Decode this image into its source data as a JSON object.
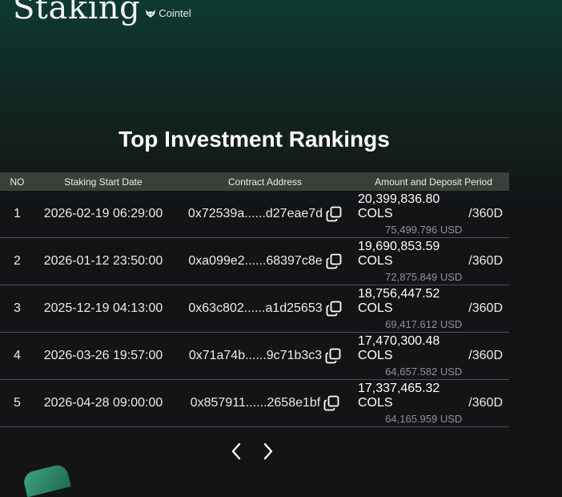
{
  "brand": {
    "title": "Staking",
    "logo_text": "Cointel"
  },
  "heading": "Top Investment Rankings",
  "table": {
    "headers": {
      "no": "NO",
      "date": "Staking Start Date",
      "address": "Contract Address",
      "amount": "Amount and Deposit Period"
    },
    "rows": [
      {
        "no": "1",
        "date": "2026-02-19 06:29:00",
        "address": "0x72539a......d27eae7d",
        "cols": "20,399,836.80 COLS",
        "usd": "75,499.796 USD",
        "period": "/360D"
      },
      {
        "no": "2",
        "date": "2026-01-12 23:50:00",
        "address": "0xa099e2......68397c8e",
        "cols": "19,690,853.59 COLS",
        "usd": "72,875.849 USD",
        "period": "/360D"
      },
      {
        "no": "3",
        "date": "2025-12-19 04:13:00",
        "address": "0x63c802......a1d25653",
        "cols": "18,756,447.52 COLS",
        "usd": "69,417.612 USD",
        "period": "/360D"
      },
      {
        "no": "4",
        "date": "2026-03-26 19:57:00",
        "address": "0x71a74b......9c71b3c3",
        "cols": "17,470,300.48 COLS",
        "usd": "64,657.582 USD",
        "period": "/360D"
      },
      {
        "no": "5",
        "date": "2026-04-28 09:00:00",
        "address": "0x857911......2658e1bf",
        "cols": "17,337,465.32 COLS",
        "usd": "64,165.959 USD",
        "period": "/360D"
      }
    ]
  },
  "pager": {
    "prev_icon": "chevron-left-icon",
    "next_icon": "chevron-right-icon"
  },
  "icons": {
    "copy": "copy-icon"
  },
  "colors": {
    "background": "#121416",
    "header_bg": "#3a4039",
    "muted": "#8e9396",
    "accent": "#0d3a30"
  }
}
